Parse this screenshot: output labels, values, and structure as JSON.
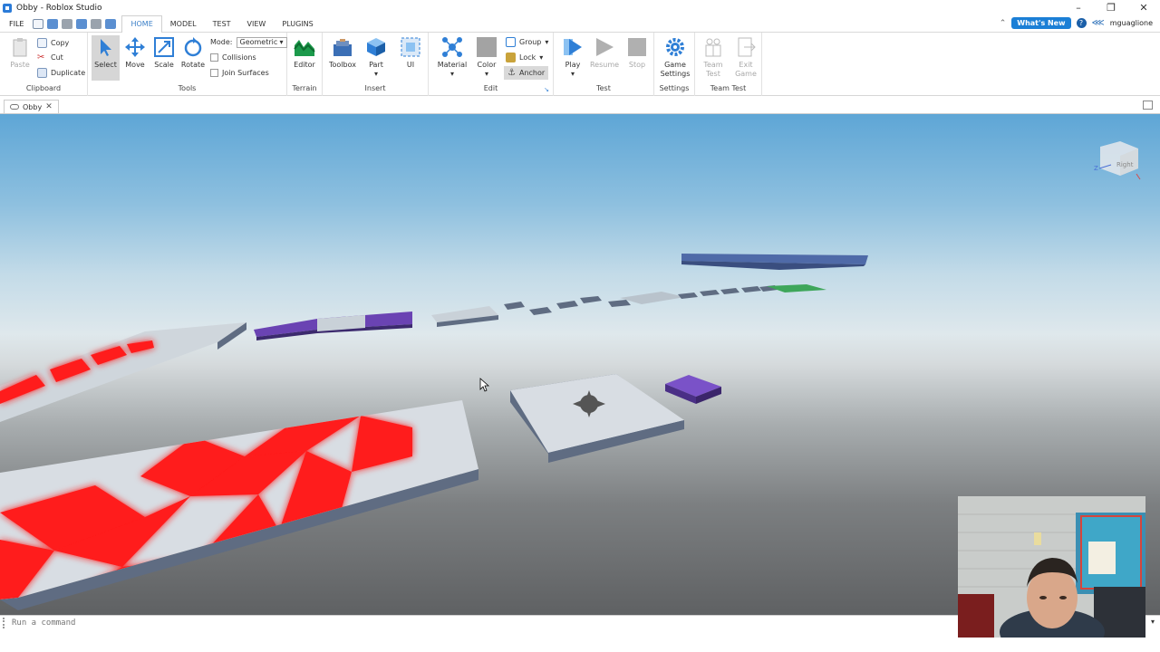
{
  "window": {
    "title": "Obby - Roblox Studio"
  },
  "menu": {
    "file": "FILE",
    "tabs": [
      "HOME",
      "MODEL",
      "TEST",
      "VIEW",
      "PLUGINS"
    ],
    "whats_new": "What's New",
    "username": "mguaglione"
  },
  "ribbon": {
    "clipboard": {
      "label": "Clipboard",
      "paste": "Paste",
      "copy": "Copy",
      "cut": "Cut",
      "duplicate": "Duplicate"
    },
    "tools": {
      "label": "Tools",
      "select": "Select",
      "move": "Move",
      "scale": "Scale",
      "rotate": "Rotate",
      "mode_label": "Mode:",
      "mode_value": "Geometric",
      "collisions": "Collisions",
      "join_surfaces": "Join Surfaces"
    },
    "terrain": {
      "label": "Terrain",
      "editor": "Editor"
    },
    "insert": {
      "label": "Insert",
      "toolbox": "Toolbox",
      "part": "Part",
      "ui": "UI"
    },
    "edit": {
      "label": "Edit",
      "material": "Material",
      "color": "Color",
      "group": "Group",
      "lock": "Lock",
      "anchor": "Anchor"
    },
    "test": {
      "label": "Test",
      "play": "Play",
      "resume": "Resume",
      "stop": "Stop"
    },
    "settings": {
      "label": "Settings",
      "game_settings_1": "Game",
      "game_settings_2": "Settings"
    },
    "team_test": {
      "label": "Team Test",
      "team_1": "Team",
      "team_2": "Test",
      "exit_1": "Exit",
      "exit_2": "Game"
    }
  },
  "doc_tab": {
    "label": "Obby"
  },
  "viewport": {
    "view_cube_label": "Right",
    "axis_label": "Z"
  },
  "command_bar": {
    "placeholder": "Run a command"
  },
  "colors": {
    "accent": "#1b7fd6",
    "checker_red": "#ff1a1a",
    "platform": "#d8dde3",
    "purple": "#6a43b3",
    "green": "#3ea65a"
  }
}
